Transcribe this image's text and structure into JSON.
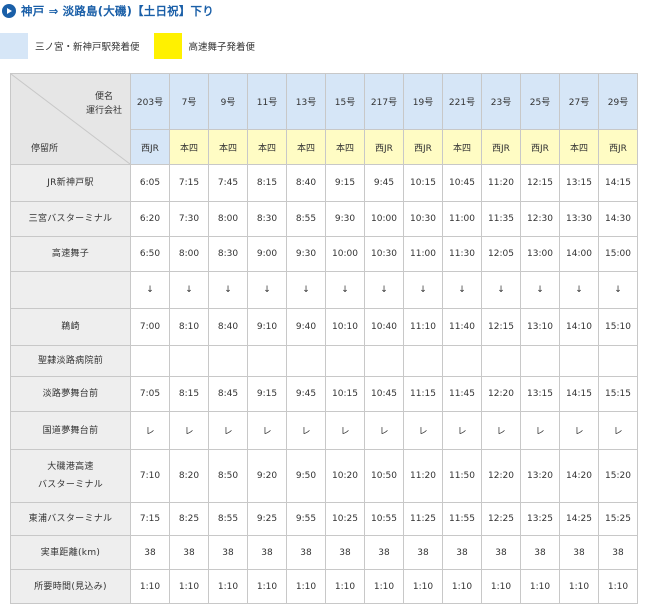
{
  "header": {
    "title": "神戸 ⇒ 淡路島(大磯)【土日祝】下り"
  },
  "legend": {
    "blue_label": "三ノ宮・新神戸駅発着便",
    "yellow_label": "高速舞子発着便",
    "colors": {
      "blue": "#d6e6f7",
      "yellow": "#fff100"
    }
  },
  "table": {
    "corner": {
      "top_line1": "便名",
      "top_line2": "運行会社",
      "bottom": "停留所"
    },
    "buses": [
      {
        "num": "203号",
        "op": "西JR",
        "color": "blue"
      },
      {
        "num": "7号",
        "op": "本四",
        "color": "yellow"
      },
      {
        "num": "9号",
        "op": "本四",
        "color": "yellow"
      },
      {
        "num": "11号",
        "op": "本四",
        "color": "yellow"
      },
      {
        "num": "13号",
        "op": "本四",
        "color": "yellow"
      },
      {
        "num": "15号",
        "op": "本四",
        "color": "yellow"
      },
      {
        "num": "217号",
        "op": "西JR",
        "color": "yellow"
      },
      {
        "num": "19号",
        "op": "西JR",
        "color": "yellow"
      },
      {
        "num": "221号",
        "op": "本四",
        "color": "yellow"
      },
      {
        "num": "23号",
        "op": "西JR",
        "color": "yellow"
      },
      {
        "num": "25号",
        "op": "西JR",
        "color": "yellow"
      },
      {
        "num": "27号",
        "op": "本四",
        "color": "yellow"
      },
      {
        "num": "29号",
        "op": "西JR",
        "color": "yellow"
      }
    ],
    "rows": [
      {
        "stop": "JR新神戸駅",
        "h": 37,
        "cells": [
          "6:05",
          "7:15",
          "7:45",
          "8:15",
          "8:40",
          "9:15",
          "9:45",
          "10:15",
          "10:45",
          "11:20",
          "12:15",
          "13:15",
          "14:15"
        ]
      },
      {
        "stop": "三宮バスターミナル",
        "h": 35,
        "cells": [
          "6:20",
          "7:30",
          "8:00",
          "8:30",
          "8:55",
          "9:30",
          "10:00",
          "10:30",
          "11:00",
          "11:35",
          "12:30",
          "13:30",
          "14:30"
        ]
      },
      {
        "stop": "高速舞子",
        "h": 35,
        "cells": [
          "6:50",
          "8:00",
          "8:30",
          "9:00",
          "9:30",
          "10:00",
          "10:30",
          "11:00",
          "11:30",
          "12:05",
          "13:00",
          "14:00",
          "15:00"
        ]
      },
      {
        "stop": "",
        "h": 37,
        "arrow": true,
        "cells": [
          "↓",
          "↓",
          "↓",
          "↓",
          "↓",
          "↓",
          "↓",
          "↓",
          "↓",
          "↓",
          "↓",
          "↓",
          "↓"
        ]
      },
      {
        "stop": "鵜崎",
        "h": 37,
        "cells": [
          "7:00",
          "8:10",
          "8:40",
          "9:10",
          "9:40",
          "10:10",
          "10:40",
          "11:10",
          "11:40",
          "12:15",
          "13:10",
          "14:10",
          "15:10"
        ]
      },
      {
        "stop": "聖隷淡路病院前",
        "h": 31,
        "cells": [
          "",
          "",
          "",
          "",
          "",
          "",
          "",
          "",
          "",
          "",
          "",
          "",
          ""
        ]
      },
      {
        "stop": "淡路夢舞台前",
        "h": 35,
        "cells": [
          "7:05",
          "8:15",
          "8:45",
          "9:15",
          "9:45",
          "10:15",
          "10:45",
          "11:15",
          "11:45",
          "12:20",
          "13:15",
          "14:15",
          "15:15"
        ]
      },
      {
        "stop": "国道夢舞台前",
        "h": 38,
        "cells": [
          "レ",
          "レ",
          "レ",
          "レ",
          "レ",
          "レ",
          "レ",
          "レ",
          "レ",
          "レ",
          "レ",
          "レ",
          "レ"
        ]
      },
      {
        "stop": "大磯港高速\nバスターミナル",
        "h": 53,
        "cells": [
          "7:10",
          "8:20",
          "8:50",
          "9:20",
          "9:50",
          "10:20",
          "10:50",
          "11:20",
          "11:50",
          "12:20",
          "13:20",
          "14:20",
          "15:20"
        ]
      },
      {
        "stop": "東浦バスターミナル",
        "h": 33,
        "cells": [
          "7:15",
          "8:25",
          "8:55",
          "9:25",
          "9:55",
          "10:25",
          "10:55",
          "11:25",
          "11:55",
          "12:25",
          "13:25",
          "14:25",
          "15:25"
        ]
      },
      {
        "stop": "実車距離(km)",
        "h": 34,
        "cells": [
          "38",
          "38",
          "38",
          "38",
          "38",
          "38",
          "38",
          "38",
          "38",
          "38",
          "38",
          "38",
          "38"
        ]
      },
      {
        "stop": "所要時間(見込み)",
        "h": 34,
        "cells": [
          "1:10",
          "1:10",
          "1:10",
          "1:10",
          "1:10",
          "1:10",
          "1:10",
          "1:10",
          "1:10",
          "1:10",
          "1:10",
          "1:10",
          "1:10"
        ]
      }
    ]
  }
}
